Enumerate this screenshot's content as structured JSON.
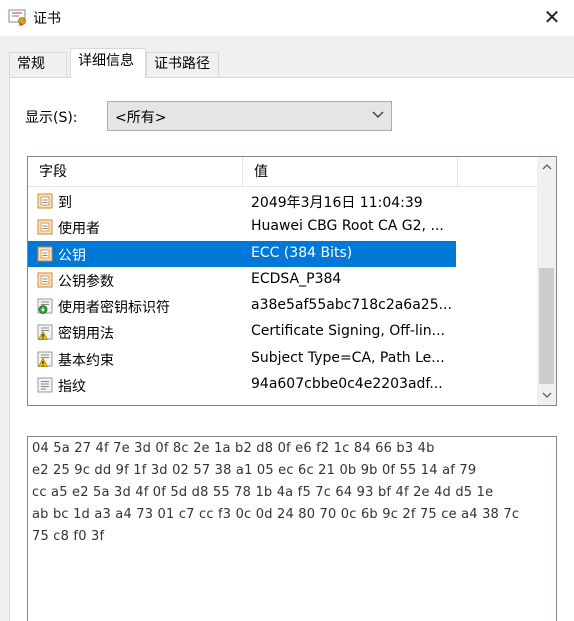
{
  "window": {
    "title": "证书",
    "close_glyph": "✕"
  },
  "tabs": [
    {
      "label": "常规",
      "active": false
    },
    {
      "label": "详细信息",
      "active": true
    },
    {
      "label": "证书路径",
      "active": false
    }
  ],
  "show": {
    "label": "显示(S):",
    "selected": "<所有>"
  },
  "table": {
    "headers": [
      "字段",
      "值"
    ],
    "rows": [
      {
        "field": "到",
        "value": "2049年3月16日 11:04:39",
        "icon": "certificate-field-icon",
        "selected": false
      },
      {
        "field": "使用者",
        "value": "Huawei CBG Root CA G2, ...",
        "icon": "certificate-field-icon",
        "selected": false
      },
      {
        "field": "公钥",
        "value": "ECC (384 Bits)",
        "icon": "certificate-field-icon",
        "selected": true
      },
      {
        "field": "公钥参数",
        "value": "ECDSA_P384",
        "icon": "certificate-field-icon",
        "selected": false
      },
      {
        "field": "使用者密钥标识符",
        "value": "a38e5af55abc718c2a6a25...",
        "icon": "extension-green-icon",
        "selected": false
      },
      {
        "field": "密钥用法",
        "value": "Certificate Signing, Off-lin...",
        "icon": "extension-warning-icon",
        "selected": false
      },
      {
        "field": "基本约束",
        "value": "Subject Type=CA, Path Le...",
        "icon": "extension-warning-icon",
        "selected": false
      },
      {
        "field": "指纹",
        "value": "94a607cbbe0c4e2203adf...",
        "icon": "property-icon",
        "selected": false
      }
    ]
  },
  "value_box": {
    "lines": [
      "04 5a 27 4f 7e 3d 0f 8c 2e 1a b2 d8 0f e6 f2 1c 84 66 b3 4b",
      "e2 25 9c dd 9f 1f 3d 02 57 38 a1 05 ec 6c 21 0b 9b 0f 55 14 af 79",
      "cc a5 e2 5a 3d 4f 0f 5d d8 55 78 1b 4a f5 7c 64 93 bf 4f 2e 4d d5 1e",
      "ab bc 1d a3 a4 73 01 c7 cc f3 0c 0d 24 80 70 0c 6b 9c 2f 75 ce a4 38 7c",
      "75 c8 f0 3f"
    ]
  }
}
